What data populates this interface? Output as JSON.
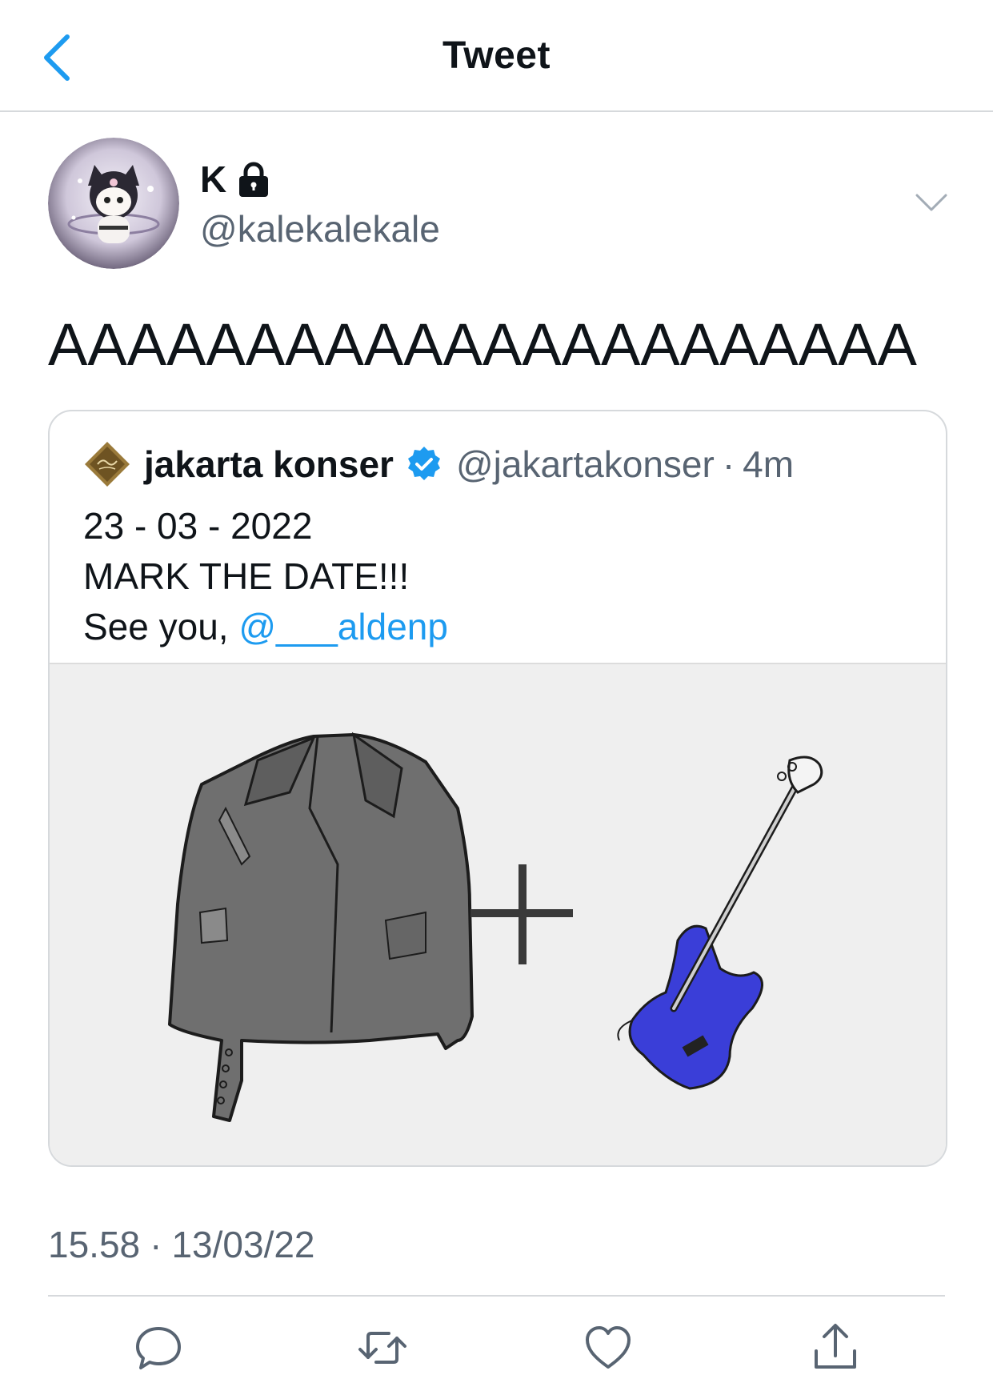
{
  "header": {
    "title": "Tweet",
    "back_icon": "chevron-left-icon"
  },
  "author": {
    "display_name": "K",
    "handle": "@kalekalekale",
    "protected_icon": "lock-icon",
    "avatar_icon": "avatar-character"
  },
  "tweet": {
    "text": "AAAAAAAAAAAAAAAAAAAAAA"
  },
  "quoted_tweet": {
    "name": "jakarta konser",
    "handle": "@jakartakonser",
    "separator": "·",
    "time": "4m",
    "avatar_icon": "jakarta-konser-logo",
    "lines": [
      "23 - 03 - 2022",
      "MARK THE DATE!!!",
      "See you, "
    ],
    "mention": "@___aldenp",
    "media_description_icons": [
      "leather-jacket",
      "plus-sign",
      "bass-guitar"
    ]
  },
  "meta": {
    "time": "15.58",
    "separator": "·",
    "date": "13/03/22"
  },
  "actions": [
    {
      "icon": "reply-icon"
    },
    {
      "icon": "retweet-icon"
    },
    {
      "icon": "like-icon"
    },
    {
      "icon": "share-icon"
    }
  ],
  "colors": {
    "accent": "#1d9bf0",
    "secondary_text": "#586472",
    "border": "#d6d9dc",
    "media_bg": "#efefef",
    "guitar_body": "#3a3ed8"
  }
}
